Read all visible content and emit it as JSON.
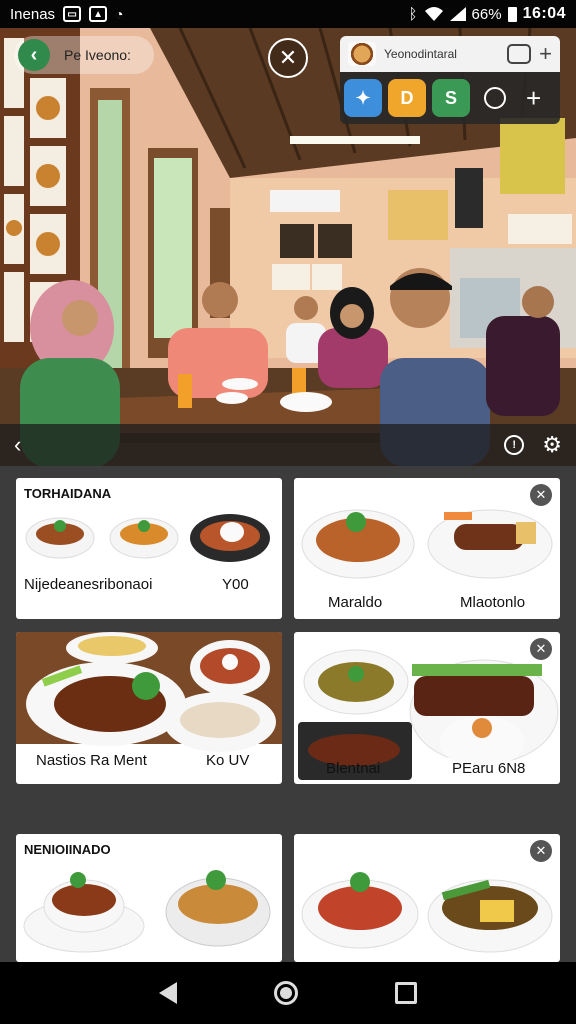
{
  "status_bar": {
    "carrier": "Inenas",
    "battery": "66%",
    "time": "16:04",
    "icons": [
      "message-icon",
      "image-icon",
      "notification-icon",
      "bluetooth-icon",
      "wifi-icon",
      "signal-icon",
      "battery-icon"
    ]
  },
  "header": {
    "back_label": "Pe Iveono:",
    "close_symbol": "✕"
  },
  "popup": {
    "title": "Yeonodintaral",
    "add_symbol": "+",
    "tiles": [
      {
        "icon": "app-blue-icon",
        "color": "#3d8fdc",
        "glyph": "✦"
      },
      {
        "icon": "app-orange-icon",
        "color": "#f0a52b",
        "glyph": "D"
      },
      {
        "icon": "app-green-icon",
        "color": "#3a9a55",
        "glyph": "S"
      }
    ]
  },
  "photo_bar": {
    "back_symbol": "‹",
    "info_symbol": "!",
    "settings_symbol": "⚙"
  },
  "cards": [
    {
      "header": "TORHAIDANA",
      "labels": [
        "Nijedeanesribonaoi",
        "Y00"
      ],
      "close": false
    },
    {
      "header": "",
      "labels": [
        "Maraldo",
        "Mlaotonlo"
      ],
      "close": true
    },
    {
      "header": "",
      "labels": [
        "Nastios Ra Ment",
        "Ko UV"
      ],
      "close": false
    },
    {
      "header": "",
      "labels": [
        "Blentnai",
        "PEaru 6N8"
      ],
      "close": true
    },
    {
      "header": "NENIOIINADO",
      "labels": [],
      "close": false
    },
    {
      "header": "",
      "labels": [],
      "close": true
    }
  ],
  "card_close_symbol": "✕"
}
